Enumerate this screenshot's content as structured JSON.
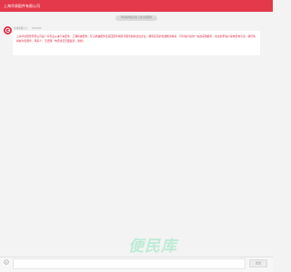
{
  "header": {
    "title": "上海华易配件有限公司"
  },
  "notice": {
    "text": "华易配件提示您 正在为您服务"
  },
  "message": {
    "sender": "在线客服小王",
    "time": "09:16:52",
    "text": "上海华易配件有限公司是一家专业从事汽车配件、工程机械配件、矿山机械配件及液压配件销售与服务的综合性企业，拥有完善的仓储物流体系，可为客户提供一站式采购服务，欢迎新老客户来电咨询洽谈，我们将竭诚为您服务，联系人：王经理，电话详见页面底部，谢谢！"
  },
  "brand": {
    "watermark": "便民库"
  },
  "input_area": {
    "placeholder": "",
    "send_label": "发送"
  },
  "colors": {
    "accent": "#e4394a",
    "message_text": "#e0283f",
    "watermark": "#bdebd6"
  },
  "icons": [
    "logo-icon",
    "emoji-icon"
  ]
}
